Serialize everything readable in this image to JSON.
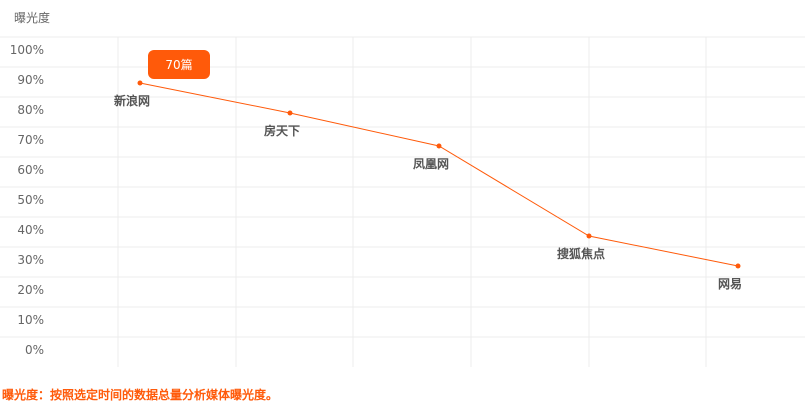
{
  "colors": {
    "accent": "#ff5a0a",
    "grid": "#ececec",
    "text": "#666666"
  },
  "chart_data": {
    "type": "line",
    "ylabel": "曝光度",
    "ylim": [
      0,
      100
    ],
    "yticks": [
      "0%",
      "10%",
      "20%",
      "30%",
      "40%",
      "50%",
      "60%",
      "70%",
      "80%",
      "90%",
      "100%"
    ],
    "categories": [
      "新浪网",
      "房天下",
      "凤凰网",
      "搜狐焦点",
      "网易"
    ],
    "series": [
      {
        "values": [
          89,
          79,
          68,
          38,
          28
        ]
      }
    ],
    "tooltip": {
      "index": 0,
      "text": "70篇"
    },
    "grid": true
  },
  "footer_note": "曝光度：按照选定时间的数据总量分析媒体曝光度。"
}
